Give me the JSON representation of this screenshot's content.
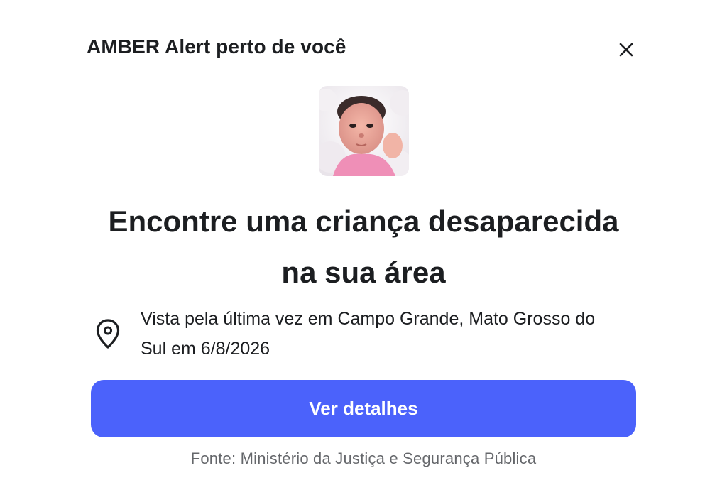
{
  "dialog": {
    "title": "AMBER Alert perto de você",
    "close_icon": "close-icon"
  },
  "child_photo": {
    "icon": "child-photo"
  },
  "headline": {
    "line1": "Encontre uma criança desaparecida",
    "line2": "na sua área"
  },
  "location": {
    "icon": "location-pin-icon",
    "text": "Vista pela última vez em Campo Grande, Mato Grosso do Sul em 6/8/2026"
  },
  "actions": {
    "details_label": "Ver detalhes",
    "accent_color": "#4b62fb"
  },
  "footer": {
    "source": "Fonte: Ministério da Justiça e Segurança Pública"
  }
}
